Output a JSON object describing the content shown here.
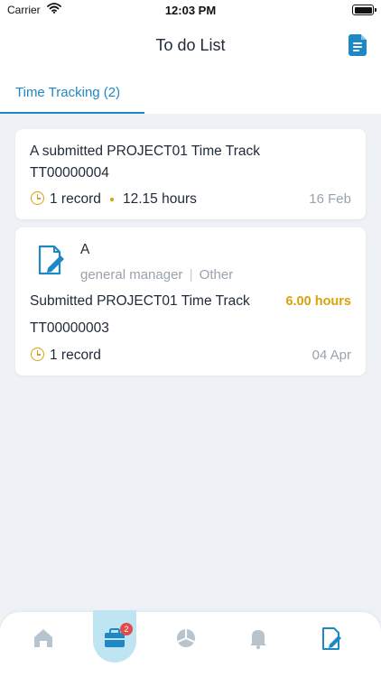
{
  "status_bar": {
    "carrier": "Carrier",
    "time": "12:03 PM"
  },
  "header": {
    "title": "To do List",
    "action_icon": "document-icon"
  },
  "tabs": [
    {
      "label": "Time Tracking (2)",
      "active": true
    }
  ],
  "cards": [
    {
      "title": "A submitted PROJECT01 Time Track",
      "code": "TT00000004",
      "records": "1 record",
      "hours": "12.15 hours",
      "date": "16 Feb"
    },
    {
      "name": "A",
      "role": "general manager",
      "department": "Other",
      "title": "Submitted PROJECT01 Time Track",
      "hours": "6.00 hours",
      "code": "TT00000003",
      "records": "1 record",
      "date": "04 Apr"
    }
  ],
  "bottom_nav": {
    "items": [
      "home-icon",
      "briefcase-icon",
      "pie-chart-icon",
      "bell-icon",
      "edit-document-icon"
    ],
    "active": "briefcase-icon",
    "badge": "2"
  },
  "colors": {
    "accent": "#1e88c7",
    "highlight": "#d8a20e",
    "badge": "#e24b4b",
    "background": "#eef2f6"
  }
}
